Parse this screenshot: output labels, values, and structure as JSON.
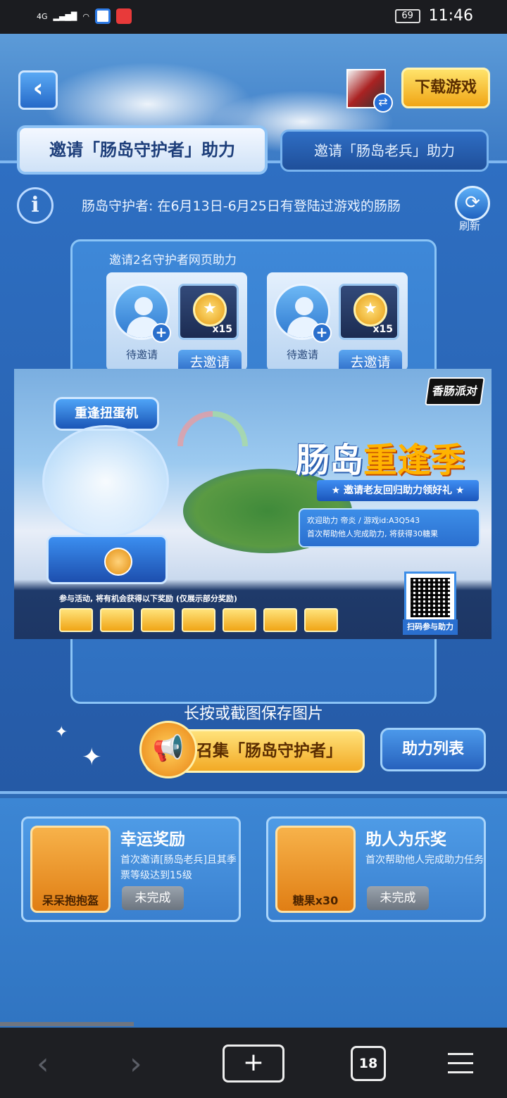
{
  "status_bar": {
    "network": "4G",
    "battery": "69",
    "time": "11:46"
  },
  "header": {
    "download_label": "下载游戏"
  },
  "tabs": {
    "active": "邀请「肠岛守护者」助力",
    "inactive": "邀请「肠岛老兵」助力"
  },
  "info": {
    "text": "肠岛守护者: 在6月13日-6月25日有登陆过游戏的肠肠",
    "refresh_label": "刷新"
  },
  "invite_box": {
    "title": "邀请2名守护者网页助力",
    "slots": [
      {
        "status": "待邀请",
        "reward_qty": "x15",
        "button": "去邀请"
      },
      {
        "status": "待邀请",
        "reward_qty": "x15",
        "button": "去邀请"
      }
    ],
    "save_tip": "长按或截图保存图片"
  },
  "poster": {
    "logo": "香肠派对",
    "gacha_title": "重逢扭蛋机",
    "title_part1": "肠岛",
    "title_part2": "重逢季",
    "subtitle": "★ 邀请老友回归助力领好礼 ★",
    "welcome_line1": "欢迎助力 帝炎 / 游戏id:A3Q543",
    "welcome_line2": "首次帮助他人完成助力, 将获得30糖果",
    "items_note": "参与活动, 将有机会获得以下奖励 (仅展示部分奖励)",
    "qr_label": "扫码参与助力"
  },
  "actions": {
    "summon_label": "召集「肠岛守护者」",
    "help_list_label": "助力列表"
  },
  "rewards": [
    {
      "item": "呆呆抱抱盔",
      "title": "幸运奖励",
      "desc": "首次邀请[肠岛老兵]且其季票等级达到15级",
      "status": "未完成"
    },
    {
      "item": "糖果x30",
      "title": "助人为乐奖",
      "desc": "首次帮助他人完成助力任务",
      "status": "未完成"
    }
  ],
  "browser_nav": {
    "tab_count": "18"
  }
}
